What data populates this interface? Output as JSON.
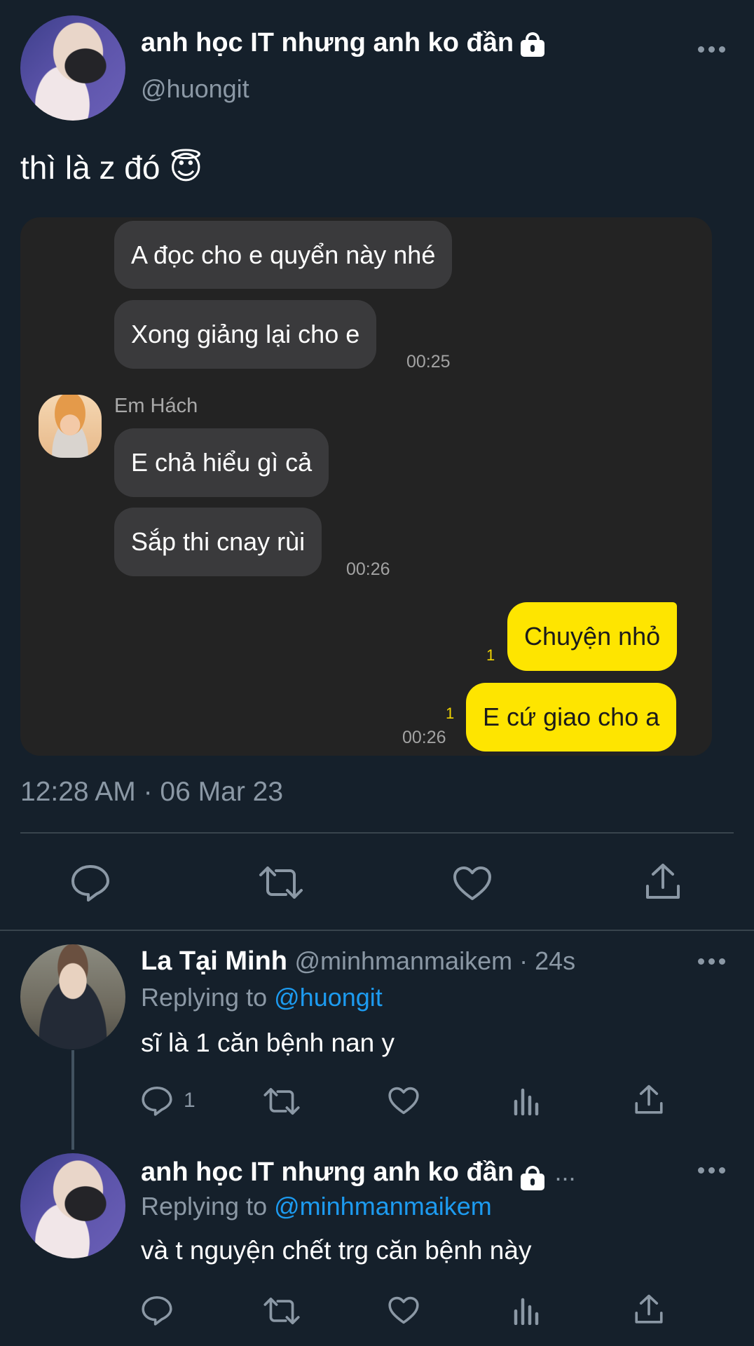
{
  "colors": {
    "background": "#15202b",
    "secondary_text": "#8b98a5",
    "link": "#1d9bf0",
    "chat_bg": "#232323",
    "incoming_bubble": "#3a3a3c",
    "outgoing_bubble": "#fee500"
  },
  "tweet": {
    "author_name": "anh học IT nhưng anh ko đần",
    "author_handle": "@huongit",
    "text": "thì là z đó 😇",
    "timestamp": "12:28 AM · 06 Mar 23",
    "chat": {
      "messages": [
        {
          "text": "A đọc cho e quyển này nhé"
        },
        {
          "text": "Xong giảng lại cho e",
          "time": "00:25"
        },
        {
          "sender": "Em Hách",
          "text": "E chả hiểu gì cả"
        },
        {
          "text": "Sắp thi cnay rùi",
          "time": "00:26"
        },
        {
          "text": "Chuyện nhỏ",
          "unread": "1"
        },
        {
          "text": "E cứ giao cho a",
          "unread": "1",
          "time": "00:26"
        }
      ]
    },
    "actions": [
      "reply-icon",
      "retweet-icon",
      "like-icon",
      "share-icon"
    ]
  },
  "replies": [
    {
      "author_name": "La Tại Minh",
      "author_handle": "@minhmanmaikem · 24s",
      "replying_prefix": "Replying to",
      "replying_to": "@huongit",
      "text": "sĩ là 1 căn bệnh nan y",
      "reply_count": "1"
    },
    {
      "author_name": "anh học IT nhưng anh ko đần",
      "author_handle": "...",
      "replying_prefix": "Replying to",
      "replying_to": "@minhmanmaikem",
      "text": "và t nguyện chết trg căn bệnh này"
    }
  ]
}
